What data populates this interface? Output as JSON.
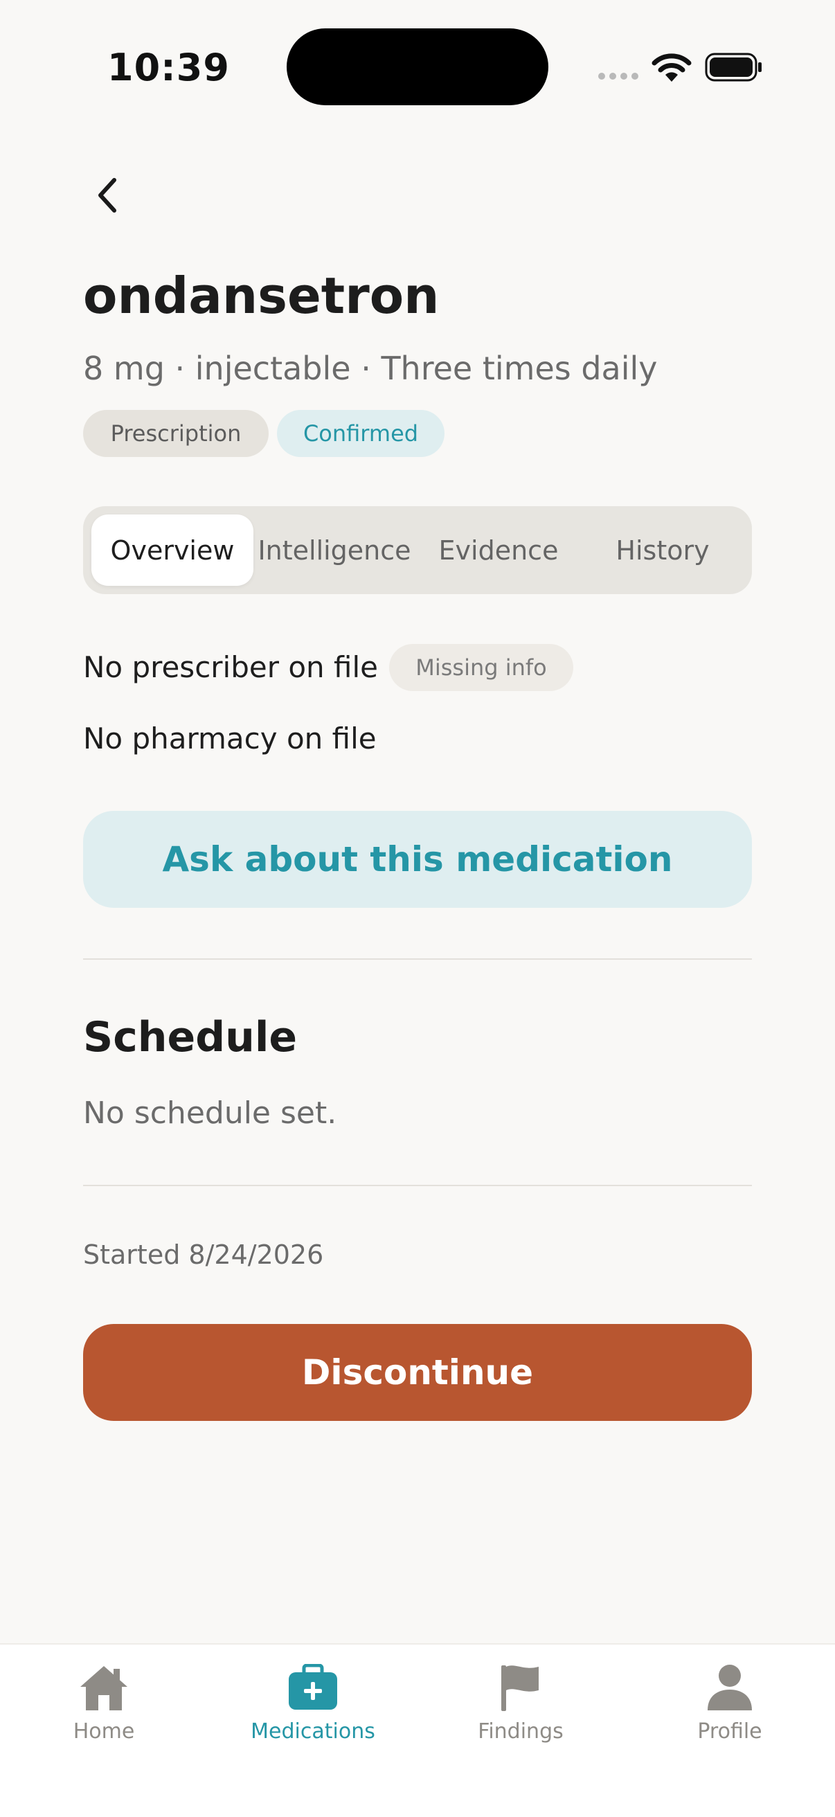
{
  "status_bar": {
    "time": "10:39"
  },
  "medication": {
    "name": "ondansetron",
    "details": "8 mg · injectable · Three times daily",
    "badges": {
      "type": "Prescription",
      "status": "Confirmed"
    }
  },
  "tabs": [
    {
      "label": "Overview",
      "active": true
    },
    {
      "label": "Intelligence",
      "active": false
    },
    {
      "label": "Evidence",
      "active": false
    },
    {
      "label": "History",
      "active": false
    }
  ],
  "overview": {
    "prescriber": "No prescriber on file",
    "prescriber_badge": "Missing info",
    "pharmacy": "No pharmacy on file",
    "ask_button": "Ask about this medication"
  },
  "schedule": {
    "title": "Schedule",
    "empty_text": "No schedule set."
  },
  "started": "Started 8/24/2026",
  "actions": {
    "discontinue": "Discontinue"
  },
  "bottom_nav": [
    {
      "label": "Home",
      "icon": "home-icon",
      "active": false
    },
    {
      "label": "Medications",
      "icon": "medical-kit-icon",
      "active": true
    },
    {
      "label": "Findings",
      "icon": "flag-icon",
      "active": false
    },
    {
      "label": "Profile",
      "icon": "person-icon",
      "active": false
    }
  ],
  "colors": {
    "background": "#f9f8f6",
    "accent_teal": "#2596a6",
    "accent_teal_bg": "#dfeef0",
    "danger": "#b85630",
    "muted_text": "#6b6b6b",
    "nav_inactive": "#8e8b86"
  }
}
